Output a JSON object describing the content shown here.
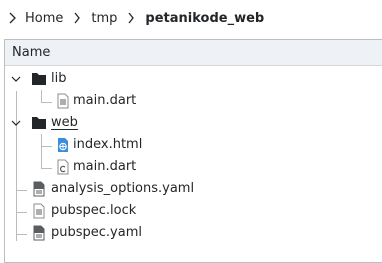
{
  "breadcrumb": {
    "items": [
      "Home",
      "tmp",
      "petanikode_web"
    ]
  },
  "header": {
    "name_column": "Name"
  },
  "tree": {
    "lib_folder": "lib",
    "lib_main": "main.dart",
    "web_folder": "web",
    "web_index": "index.html",
    "web_main": "main.dart",
    "analysis": "analysis_options.yaml",
    "pubspec_lock": "pubspec.lock",
    "pubspec_yaml": "pubspec.yaml"
  },
  "colors": {
    "text": "#232629",
    "header_bg": "#eef1f5",
    "html_icon": "#3c8ddb",
    "folder": "#232629"
  }
}
